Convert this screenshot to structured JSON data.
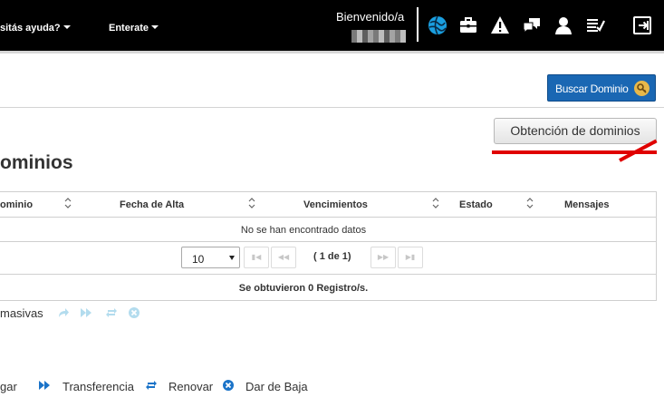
{
  "nav": {
    "help_label": "sitás ayuda?",
    "news_label": "Enterate",
    "welcome": "Bienvenido/a"
  },
  "toolbar": {
    "buscar_label": "Buscar Dominio",
    "obtencion_label": "Obtención de dominios"
  },
  "page": {
    "title": "ominios"
  },
  "table": {
    "columns": [
      "ominio",
      "Fecha de Alta",
      "Vencimientos",
      "Estado",
      "Mensajes"
    ],
    "empty_message": "No se han encontrado datos",
    "page_size": "10",
    "page_info": "( 1 de 1)",
    "record_count": "Se obtuvieron 0 Registro/s."
  },
  "bulk": {
    "label": " masivas"
  },
  "legend": {
    "items": [
      "gar",
      "Transferencia",
      "Renovar",
      "Dar de Baja"
    ]
  },
  "colors": {
    "topbar": "#000000",
    "accent_blue": "#1a67b3",
    "icon_blue": "#1a73c8",
    "icon_light": "#b3dcee",
    "annotation_red": "#e00000"
  }
}
